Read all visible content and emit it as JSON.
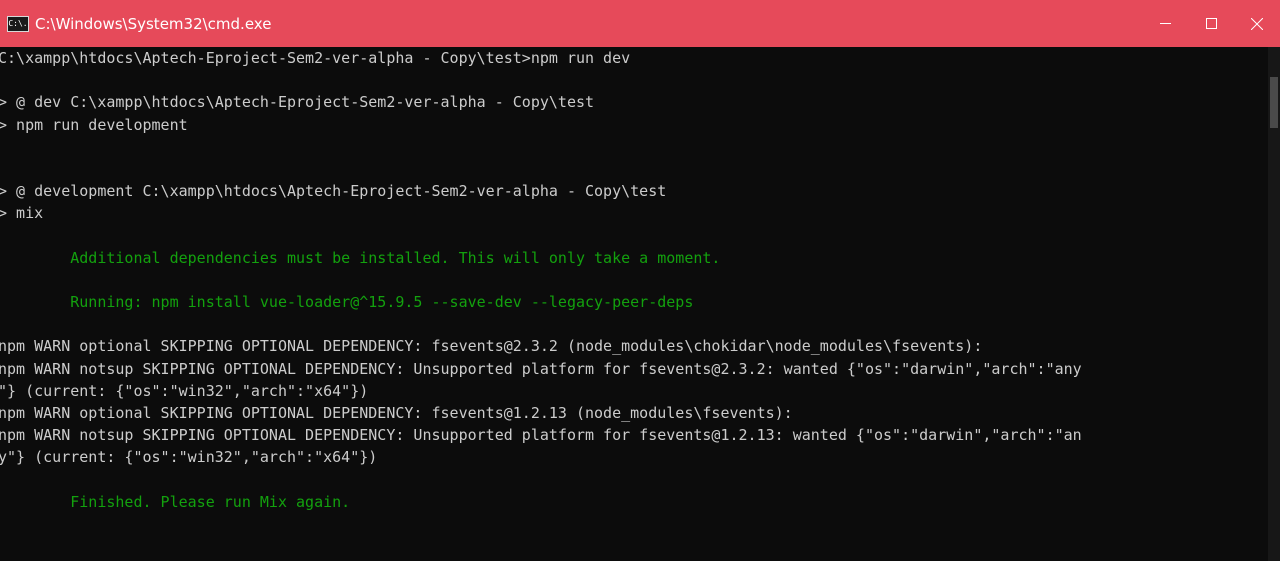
{
  "window": {
    "title": "C:\\Windows\\System32\\cmd.exe",
    "icon_text": "C:\\.",
    "titlebar_color": "#e64a5a",
    "controls": [
      "minimize-icon",
      "maximize-icon",
      "close-icon"
    ]
  },
  "console": {
    "text_color": "#cccccc",
    "success_color": "#13a10e",
    "lines": [
      {
        "text": "C:\\xampp\\htdocs\\Aptech-Eproject-Sem2-ver-alpha - Copy\\test>npm run dev",
        "style": "normal"
      },
      {
        "text": "",
        "style": "normal"
      },
      {
        "text": "> @ dev C:\\xampp\\htdocs\\Aptech-Eproject-Sem2-ver-alpha - Copy\\test",
        "style": "normal"
      },
      {
        "text": "> npm run development",
        "style": "normal"
      },
      {
        "text": "",
        "style": "normal"
      },
      {
        "text": "",
        "style": "normal"
      },
      {
        "text": "> @ development C:\\xampp\\htdocs\\Aptech-Eproject-Sem2-ver-alpha - Copy\\test",
        "style": "normal"
      },
      {
        "text": "> mix",
        "style": "normal"
      },
      {
        "text": "",
        "style": "normal"
      },
      {
        "text": "        Additional dependencies must be installed. This will only take a moment.",
        "style": "green"
      },
      {
        "text": "",
        "style": "normal"
      },
      {
        "text": "        Running: npm install vue-loader@^15.9.5 --save-dev --legacy-peer-deps",
        "style": "green"
      },
      {
        "text": "",
        "style": "normal"
      },
      {
        "text": "npm WARN optional SKIPPING OPTIONAL DEPENDENCY: fsevents@2.3.2 (node_modules\\chokidar\\node_modules\\fsevents):",
        "style": "normal"
      },
      {
        "text": "npm WARN notsup SKIPPING OPTIONAL DEPENDENCY: Unsupported platform for fsevents@2.3.2: wanted {\"os\":\"darwin\",\"arch\":\"any",
        "style": "normal"
      },
      {
        "text": "\"} (current: {\"os\":\"win32\",\"arch\":\"x64\"})",
        "style": "normal"
      },
      {
        "text": "npm WARN optional SKIPPING OPTIONAL DEPENDENCY: fsevents@1.2.13 (node_modules\\fsevents):",
        "style": "normal"
      },
      {
        "text": "npm WARN notsup SKIPPING OPTIONAL DEPENDENCY: Unsupported platform for fsevents@1.2.13: wanted {\"os\":\"darwin\",\"arch\":\"an",
        "style": "normal"
      },
      {
        "text": "y\"} (current: {\"os\":\"win32\",\"arch\":\"x64\"})",
        "style": "normal"
      },
      {
        "text": "",
        "style": "normal"
      },
      {
        "text": "        Finished. Please run Mix again.",
        "style": "green"
      }
    ]
  },
  "scrollbar": {
    "thumb_start_fraction": 0.0,
    "thumb_size_fraction": 0.1
  }
}
